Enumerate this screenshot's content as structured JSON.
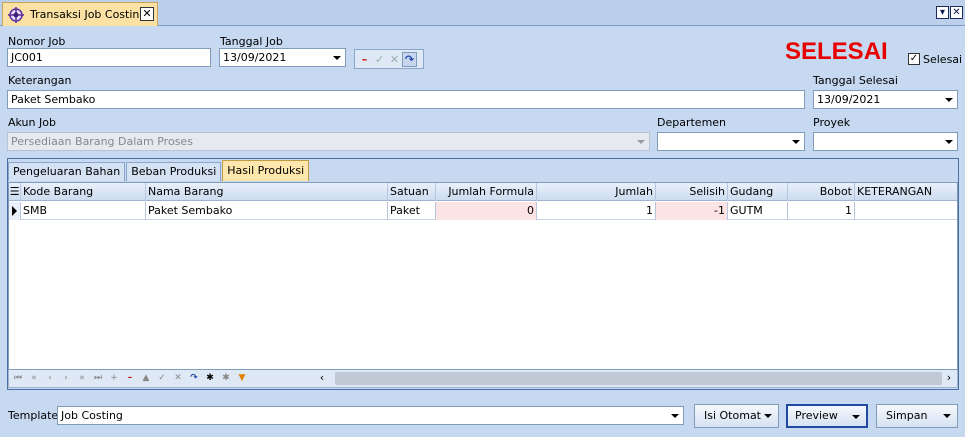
{
  "tab": {
    "title": "Transaksi Job Costing",
    "close": "✕"
  },
  "window_controls": {
    "dropdown": "▾",
    "close": "✕"
  },
  "form": {
    "nomor_job_label": "Nomor Job",
    "nomor_job_value": "JC001",
    "tanggal_job_label": "Tanggal Job",
    "tanggal_job_value": "13/09/2021",
    "status_text": "SELESAI",
    "selesai_label": "Selesai",
    "selesai_checked": true,
    "keterangan_label": "Keterangan",
    "keterangan_value": "Paket Sembako",
    "tanggal_selesai_label": "Tanggal Selesai",
    "tanggal_selesai_value": "13/09/2021",
    "akun_job_label": "Akun Job",
    "akun_job_value": "Persediaan Barang Dalam Proses",
    "departemen_label": "Departemen",
    "departemen_value": "",
    "proyek_label": "Proyek",
    "proyek_value": ""
  },
  "panel_tabs": [
    "Pengeluaran Bahan",
    "Beban Produksi",
    "Hasil Produksi"
  ],
  "active_tab": "Hasil Produksi",
  "grid": {
    "columns": [
      "Kode Barang",
      "Nama Barang",
      "Satuan",
      "Jumlah Formula",
      "Jumlah",
      "Selisih",
      "Gudang",
      "Bobot",
      "KETERANGAN"
    ],
    "rows": [
      [
        "SMB",
        "Paket Sembako",
        "Paket",
        "0",
        "1",
        "-1",
        "GUTM",
        "1",
        ""
      ]
    ]
  },
  "footer": {
    "template_label": "Template",
    "template_value": "Job Costing",
    "buttons": [
      "Isi Otomat",
      "Preview",
      "Simpan"
    ]
  },
  "colors": {
    "status": "#e80000",
    "active_tab": "#fde7ad",
    "pink_cell": "#fde4e4"
  }
}
